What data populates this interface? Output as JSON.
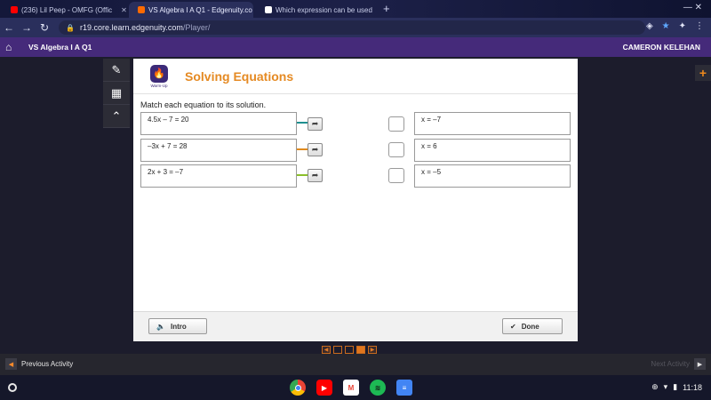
{
  "browser": {
    "tabs": [
      {
        "label": "(236) Lil Peep - OMFG (Offic",
        "favicon_color": "#ff0000"
      },
      {
        "label": "VS Algebra I A Q1 - Edgenuity.co",
        "favicon_color": "#ff6a00"
      },
      {
        "label": "Which expression can be used",
        "favicon_color": "#ffffff"
      }
    ],
    "url_host": "r19.core.learn.edgenuity.com",
    "url_path": "/Player/"
  },
  "header": {
    "course": "VS Algebra I A Q1",
    "user": "CAMERON KELEHAN"
  },
  "activity": {
    "badge_label": "Warm-Up",
    "title": "Solving Equations",
    "instructions": "Match each equation to its solution.",
    "equations": [
      "4.5x – 7 = 20",
      "–3x + 7 = 28",
      "2x + 3 = –7"
    ],
    "solutions": [
      "x = –7",
      "x = 6",
      "x = –5"
    ],
    "connector_colors": [
      "#1f8f8f",
      "#e08a1e",
      "#8bbf2a"
    ]
  },
  "footer": {
    "intro_label": "Intro",
    "done_label": "Done"
  },
  "nav": {
    "previous_label": "Previous Activity",
    "next_label": "Next Activity"
  },
  "shelf": {
    "time": "11:18"
  }
}
